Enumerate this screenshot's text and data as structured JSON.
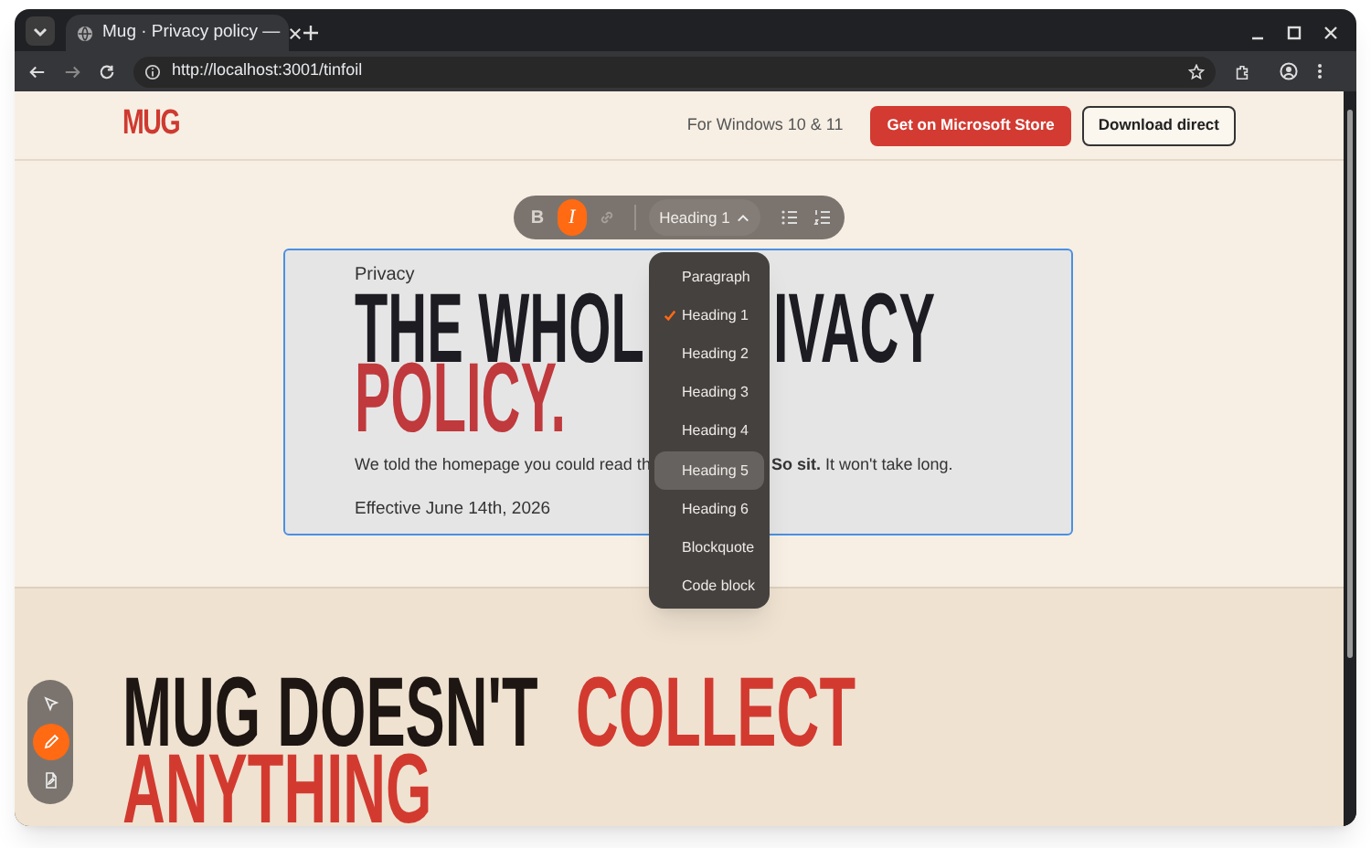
{
  "browser": {
    "tab_title": "Mug · Privacy policy —",
    "url": "http://localhost:3001/tinfoil"
  },
  "header": {
    "logo": "MUG",
    "platform_note": "For Windows 10 & 11",
    "buttons": [
      {
        "label": "Get on Microsoft Store",
        "kind": "primary"
      },
      {
        "label": "Download direct",
        "kind": "outline"
      }
    ]
  },
  "format_toolbar": {
    "tools": [
      {
        "kind": "bold",
        "label": "B",
        "selected": false
      },
      {
        "kind": "italic",
        "label": "I",
        "selected": true
      },
      {
        "kind": "link",
        "disabled": true
      }
    ],
    "block_type": "Heading 1",
    "expanded": true
  },
  "block_menu": [
    {
      "label": "Paragraph",
      "selected": false,
      "highlighted": false
    },
    {
      "label": "Heading 1",
      "selected": true,
      "highlighted": false
    },
    {
      "label": "Heading 2",
      "selected": false,
      "highlighted": false
    },
    {
      "label": "Heading 3",
      "selected": false,
      "highlighted": false
    },
    {
      "label": "Heading 4",
      "selected": false,
      "highlighted": false
    },
    {
      "label": "Heading 5",
      "selected": false,
      "highlighted": true
    },
    {
      "label": "Heading 6",
      "selected": false,
      "highlighted": false
    },
    {
      "label": "Blockquote",
      "selected": false,
      "highlighted": false
    },
    {
      "label": "Code block",
      "selected": false,
      "highlighted": false
    }
  ],
  "editor": {
    "selected": true,
    "eyebrow": "Privacy",
    "title_line_1_left": "THE WHOL",
    "title_line_1_right": "IVACY",
    "title_line_2": "POLICY.",
    "intro_left": "We told the homepage you could read th",
    "intro_right": "**So sit.** It won't take long.",
    "effective": "Effective June 14th, 2026"
  },
  "section_2": {
    "headline_dark": "MUG DOESN'T",
    "headline_accent": "COLLECT",
    "headline_line_2": "ANYTHING"
  },
  "side_tools": [
    {
      "kind": "pointer",
      "selected": false
    },
    {
      "kind": "pen",
      "selected": true
    },
    {
      "kind": "file",
      "selected": false
    }
  ]
}
